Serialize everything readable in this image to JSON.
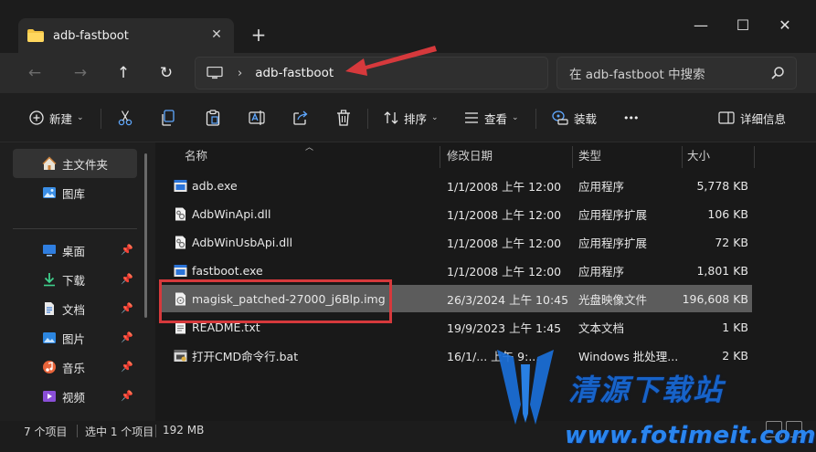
{
  "window": {
    "tab_title": "adb-fastboot",
    "tab_close": "✕",
    "new_tab": "+",
    "minimize": "—",
    "maximize": "☐",
    "close": "✕"
  },
  "nav": {
    "back": "←",
    "forward": "→",
    "up": "↑",
    "refresh": "↻",
    "chevron": "›",
    "breadcrumb": "adb-fastboot",
    "search_placeholder": "在 adb-fastboot 中搜索"
  },
  "toolbar": {
    "new_label": "新建",
    "sort_label": "排序",
    "view_label": "查看",
    "install_label": "装载",
    "more_label": "•••",
    "details_label": "详细信息"
  },
  "sidebar": {
    "items": [
      {
        "label": "主文件夹",
        "icon": "home-icon"
      },
      {
        "label": "图库",
        "icon": "gallery-icon"
      },
      {
        "label": "桌面",
        "icon": "desktop-icon"
      },
      {
        "label": "下载",
        "icon": "download-icon"
      },
      {
        "label": "文档",
        "icon": "documents-icon"
      },
      {
        "label": "图片",
        "icon": "pictures-icon"
      },
      {
        "label": "音乐",
        "icon": "music-icon"
      },
      {
        "label": "视频",
        "icon": "videos-icon"
      }
    ]
  },
  "columns": {
    "name": "名称",
    "date": "修改日期",
    "type": "类型",
    "size": "大小"
  },
  "files": [
    {
      "name": "adb.exe",
      "date": "1/1/2008 上午 12:00",
      "type": "应用程序",
      "size": "5,778 KB",
      "icon": "exe-icon"
    },
    {
      "name": "AdbWinApi.dll",
      "date": "1/1/2008 上午 12:00",
      "type": "应用程序扩展",
      "size": "106 KB",
      "icon": "dll-icon"
    },
    {
      "name": "AdbWinUsbApi.dll",
      "date": "1/1/2008 上午 12:00",
      "type": "应用程序扩展",
      "size": "72 KB",
      "icon": "dll-icon"
    },
    {
      "name": "fastboot.exe",
      "date": "1/1/2008 上午 12:00",
      "type": "应用程序",
      "size": "1,801 KB",
      "icon": "exe-icon"
    },
    {
      "name": "magisk_patched-27000_j6Blp.img",
      "date": "26/3/2024 上午 10:45",
      "type": "光盘映像文件",
      "size": "196,608 KB",
      "icon": "disc-image-icon"
    },
    {
      "name": "README.txt",
      "date": "19/9/2023 上午 1:45",
      "type": "文本文档",
      "size": "1 KB",
      "icon": "text-file-icon"
    },
    {
      "name": "打开CMD命令行.bat",
      "date": "16/1/... 上午 9:...",
      "type": "Windows 批处理...",
      "size": "2 KB",
      "icon": "batch-file-icon"
    }
  ],
  "status": {
    "count": "7 个项目",
    "selected": "选中 1 个项目",
    "size": "192 MB"
  },
  "watermark": {
    "text": "清源下载站",
    "url": "www.fotimeit.com"
  },
  "colors": {
    "background": "#191919",
    "selected_row": "#5c5c5c",
    "annotation_red": "#d6393c",
    "watermark_blue": "#1763c9"
  }
}
